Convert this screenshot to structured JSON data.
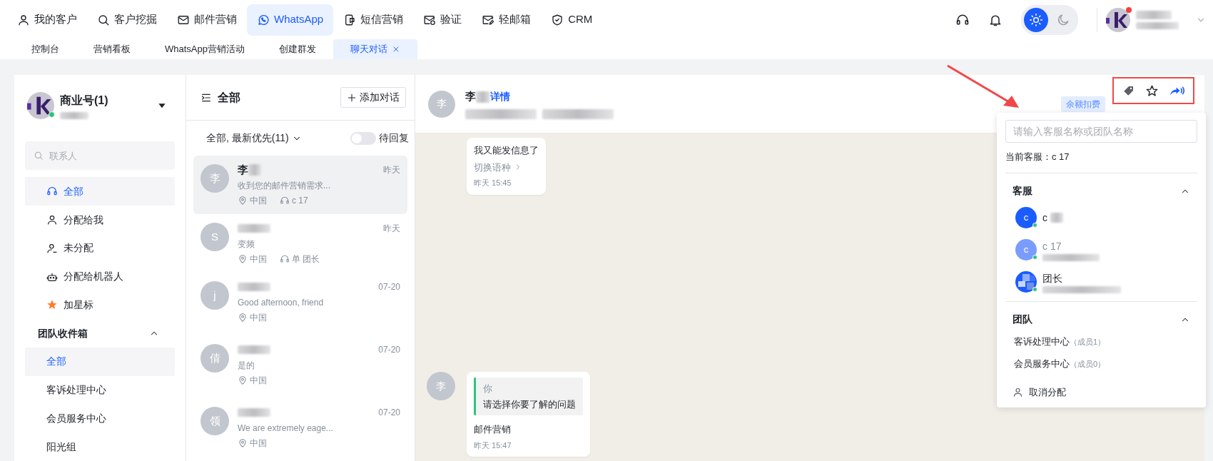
{
  "top_nav": {
    "items": [
      {
        "label": "我的客户",
        "kind": "user",
        "selected": false
      },
      {
        "label": "客户挖掘",
        "kind": "search",
        "selected": false
      },
      {
        "label": "邮件营销",
        "kind": "mail",
        "selected": false
      },
      {
        "label": "WhatsApp",
        "kind": "whatsapp",
        "selected": true
      },
      {
        "label": "短信营销",
        "kind": "sms",
        "selected": false
      },
      {
        "label": "验证",
        "kind": "mail-check",
        "selected": false
      },
      {
        "label": "轻邮箱",
        "kind": "mail-edit",
        "selected": false
      },
      {
        "label": "CRM",
        "kind": "shield",
        "selected": false
      }
    ],
    "theme": [
      {
        "kind": "sun",
        "selected": true
      },
      {
        "kind": "moon",
        "selected": false
      }
    ],
    "notification_dot": true
  },
  "page_tabs": [
    {
      "label": "控制台",
      "selected": false,
      "closable": false
    },
    {
      "label": "营销看板",
      "selected": false,
      "closable": false
    },
    {
      "label": "WhatsApp营销活动",
      "selected": false,
      "closable": false
    },
    {
      "label": "创建群发",
      "selected": false,
      "closable": false
    },
    {
      "label": "聊天对话",
      "selected": true,
      "closable": true
    }
  ],
  "sidebar": {
    "account": {
      "name": "商业号(1)",
      "online": true
    },
    "search": {
      "placeholder": "联系人"
    },
    "items": [
      {
        "label": "全部",
        "kind": "headset",
        "selected": true
      },
      {
        "label": "分配给我",
        "kind": "user",
        "selected": false
      },
      {
        "label": "未分配",
        "kind": "user-minus",
        "selected": false
      },
      {
        "label": "分配给机器人",
        "kind": "robot",
        "selected": false
      },
      {
        "label": "加星标",
        "kind": "star",
        "selected": false
      }
    ],
    "group": {
      "title": "团队收件箱",
      "expanded": true,
      "items": [
        {
          "label": "全部",
          "selected": true
        },
        {
          "label": "客诉处理中心",
          "selected": false
        },
        {
          "label": "会员服务中心",
          "selected": false
        },
        {
          "label": "阳光组",
          "selected": false
        }
      ]
    }
  },
  "conversations": {
    "title": "全部",
    "add_button": "添加对话",
    "filter": "全部, 最新优先(11)",
    "pending_toggle": {
      "label": "待回复",
      "on": false
    },
    "items": [
      {
        "avatar": "李",
        "name": "李",
        "preview": "收到您的邮件营销需求...",
        "time": "昨天",
        "location": "中国",
        "agent": "c 17",
        "selected": true
      },
      {
        "avatar": "S",
        "preview": "变频",
        "time": "昨天",
        "location": "中国",
        "agent": "单 团长",
        "selected": false
      },
      {
        "avatar": "j",
        "preview": "Good afternoon, friend",
        "time": "07-20",
        "location": "中国",
        "selected": false
      },
      {
        "avatar": "倩",
        "preview": "是的",
        "time": "07-20",
        "location": "中国",
        "selected": false
      },
      {
        "avatar": "领",
        "preview": "We are extremely eage...",
        "time": "07-20",
        "location": "中国",
        "selected": false
      }
    ]
  },
  "chat": {
    "contact": {
      "avatar": "李",
      "name": "李",
      "details_link": "详情"
    },
    "badge": "余额扣费",
    "messages": [
      {
        "kind": "text",
        "text": "我又能发信息了",
        "action": "切换语种",
        "time": "昨天 15:45"
      },
      {
        "kind": "quote",
        "avatar": "李",
        "quote_author": "你",
        "quote_text": "请选择你要了解的问题",
        "text": "邮件营销",
        "time": "昨天 15:47"
      }
    ]
  },
  "assign_popup": {
    "search": {
      "placeholder": "请输入客服名称或团队名称"
    },
    "current": "当前客服：c 17",
    "agents": {
      "title": "客服",
      "expanded": true,
      "items": [
        {
          "initial": "c",
          "name": "c",
          "color": "#1a5cff",
          "online": true
        },
        {
          "initial": "c",
          "name": "c 17",
          "color": "#7b9cff",
          "online": true
        },
        {
          "kind": "picture",
          "name": "团长",
          "online": true
        }
      ]
    },
    "teams": {
      "title": "团队",
      "expanded": true,
      "items": [
        {
          "name": "客诉处理中心",
          "count": "（成员1）"
        },
        {
          "name": "会员服务中心",
          "count": "（成员0）"
        }
      ]
    },
    "unassign": "取消分配"
  }
}
